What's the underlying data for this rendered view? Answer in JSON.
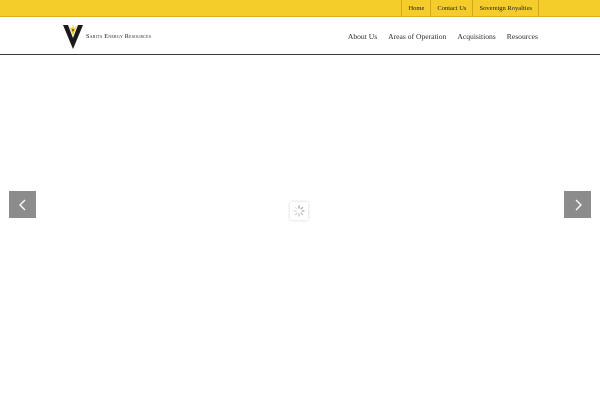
{
  "topbar": {
    "links": [
      "Home",
      "Contact Us",
      "Sovereign Royalties"
    ],
    "background": "#f5cd2a"
  },
  "header": {
    "logo_text": "Sarita Energy Resources",
    "nav": [
      "About Us",
      "Areas of Operation",
      "Acquisitions",
      "Resources"
    ]
  },
  "slider": {
    "prev_icon": "chevron-left-icon",
    "next_icon": "chevron-right-icon",
    "loading_icon": "spinner-icon",
    "arrow_color": "#8c8c8c"
  }
}
